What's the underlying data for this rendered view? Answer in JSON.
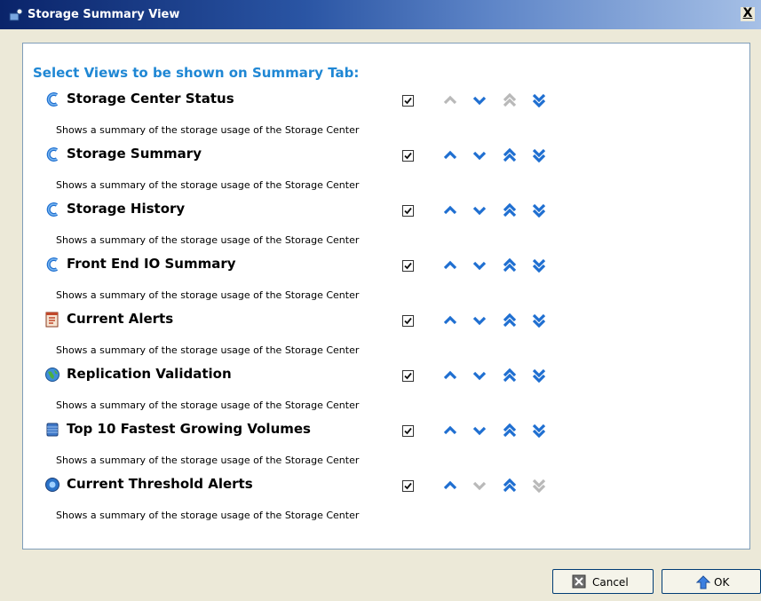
{
  "window": {
    "title": "Storage Summary View",
    "close_glyph": "X"
  },
  "heading": "Select Views to be shown on Summary Tab:",
  "rows": [
    {
      "title": "Storage Center Status",
      "description": "Shows a summary of the storage usage of the Storage Center",
      "icon": "storage-center-icon",
      "checked": true,
      "up_enabled": false,
      "down_enabled": true,
      "top_enabled": false,
      "bottom_enabled": true
    },
    {
      "title": "Storage Summary",
      "description": "Shows a summary of the storage usage of the Storage Center",
      "icon": "storage-center-icon",
      "checked": true,
      "up_enabled": true,
      "down_enabled": true,
      "top_enabled": true,
      "bottom_enabled": true
    },
    {
      "title": "Storage History",
      "description": "Shows a summary of the storage usage of the Storage Center",
      "icon": "storage-center-icon",
      "checked": true,
      "up_enabled": true,
      "down_enabled": true,
      "top_enabled": true,
      "bottom_enabled": true
    },
    {
      "title": "Front End IO Summary",
      "description": "Shows a summary of the storage usage of the Storage Center",
      "icon": "storage-center-icon",
      "checked": true,
      "up_enabled": true,
      "down_enabled": true,
      "top_enabled": true,
      "bottom_enabled": true
    },
    {
      "title": "Current Alerts",
      "description": "Shows a summary of the storage usage of the Storage Center",
      "icon": "alerts-icon",
      "checked": true,
      "up_enabled": true,
      "down_enabled": true,
      "top_enabled": true,
      "bottom_enabled": true
    },
    {
      "title": "Replication Validation",
      "description": "Shows a summary of the storage usage of the Storage Center",
      "icon": "globe-icon",
      "checked": true,
      "up_enabled": true,
      "down_enabled": true,
      "top_enabled": true,
      "bottom_enabled": true
    },
    {
      "title": "Top 10 Fastest Growing Volumes",
      "description": "Shows a summary of the storage usage of the Storage Center",
      "icon": "volume-icon",
      "checked": true,
      "up_enabled": true,
      "down_enabled": true,
      "top_enabled": true,
      "bottom_enabled": true
    },
    {
      "title": "Current Threshold Alerts",
      "description": "Shows a summary of the storage usage of the Storage Center",
      "icon": "threshold-icon",
      "checked": true,
      "up_enabled": true,
      "down_enabled": false,
      "top_enabled": true,
      "bottom_enabled": false
    }
  ],
  "buttons": {
    "cancel_label": "Cancel",
    "ok_label": "OK"
  },
  "colors": {
    "heading": "#1f87d4",
    "arrow_enabled": "#1f6fd1",
    "arrow_disabled": "#b9b9b9",
    "titlebar": "#0a246a"
  }
}
